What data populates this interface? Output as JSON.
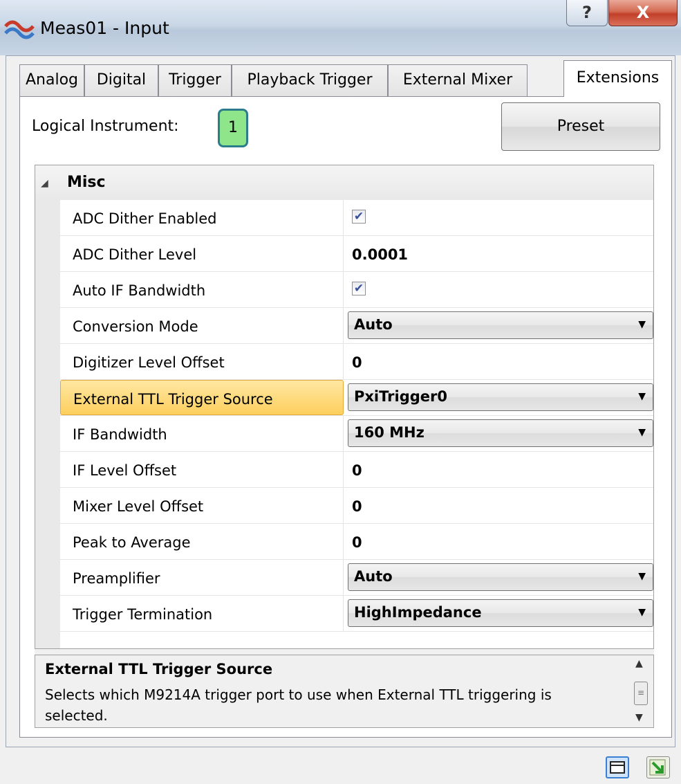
{
  "window": {
    "title": "Meas01 - Input",
    "help_label": "?",
    "close_label": "X"
  },
  "tabs": [
    {
      "label": "Analog"
    },
    {
      "label": "Digital"
    },
    {
      "label": "Trigger"
    },
    {
      "label": "Playback Trigger"
    },
    {
      "label": "External Mixer"
    },
    {
      "label": "Extensions",
      "active": true
    }
  ],
  "header": {
    "logical_instrument_label": "Logical Instrument:",
    "logical_instrument_value": "1",
    "preset_label": "Preset"
  },
  "grid": {
    "category": "Misc",
    "rows": [
      {
        "name": "ADC Dither Enabled",
        "type": "checkbox",
        "value": "✔"
      },
      {
        "name": "ADC Dither Level",
        "type": "text",
        "value": "0.0001"
      },
      {
        "name": "Auto IF Bandwidth",
        "type": "checkbox",
        "value": "✔"
      },
      {
        "name": "Conversion Mode",
        "type": "combo",
        "value": "Auto"
      },
      {
        "name": "Digitizer Level Offset",
        "type": "text",
        "value": "0"
      },
      {
        "name": "External TTL Trigger Source",
        "type": "combo",
        "value": "PxiTrigger0",
        "selected": true
      },
      {
        "name": "IF Bandwidth",
        "type": "combo",
        "value": "160 MHz"
      },
      {
        "name": "IF Level Offset",
        "type": "text",
        "value": "0"
      },
      {
        "name": "Mixer Level Offset",
        "type": "text",
        "value": "0"
      },
      {
        "name": "Peak to Average",
        "type": "text",
        "value": "0"
      },
      {
        "name": "Preamplifier",
        "type": "combo",
        "value": "Auto"
      },
      {
        "name": "Trigger Termination",
        "type": "combo",
        "value": "HighImpedance"
      }
    ]
  },
  "description": {
    "title": "External TTL Trigger Source",
    "text": "Selects which M9214A trigger port to use when External TTL triggering is selected."
  },
  "colors": {
    "selected_row": "#fdcf5e",
    "logical_instrument_bg": "#8fe58a"
  }
}
